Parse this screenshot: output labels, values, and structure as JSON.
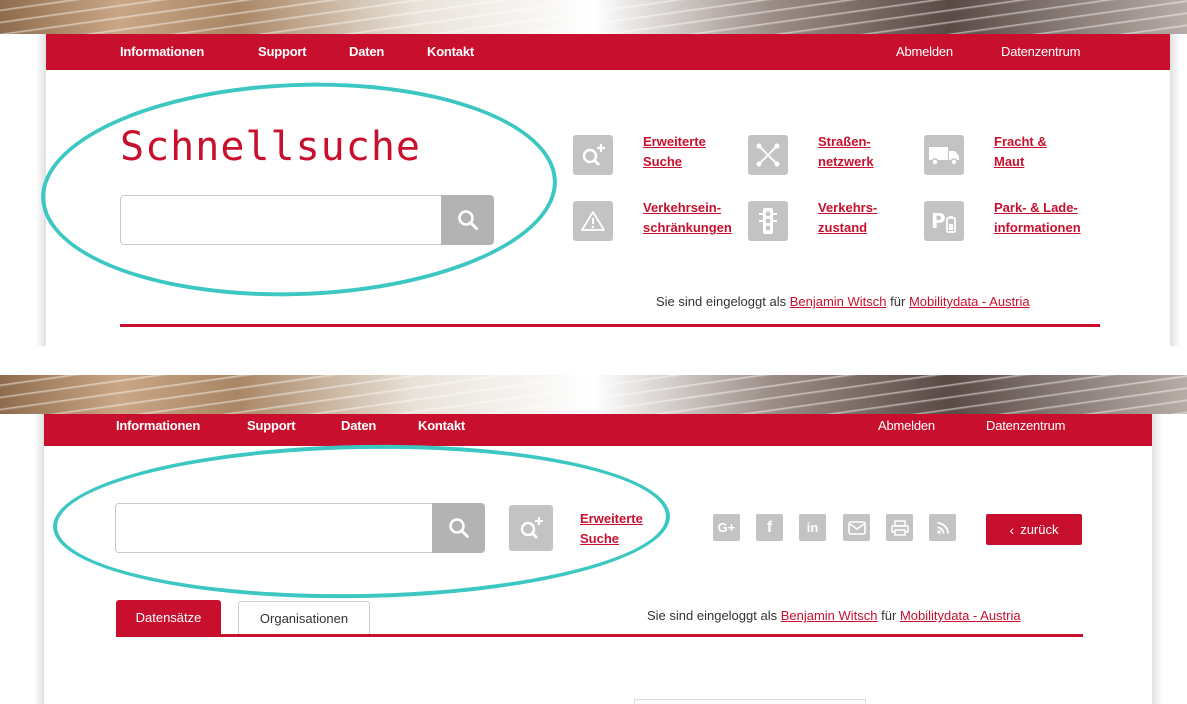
{
  "nav": {
    "left": [
      "Informationen",
      "Support",
      "Daten",
      "Kontakt"
    ],
    "right": [
      "Abmelden",
      "Datenzentrum"
    ]
  },
  "quick_search": {
    "title": "Schnellsuche",
    "search_value": ""
  },
  "quick_links": [
    {
      "icon": "search-plus-icon",
      "line1": "Erweiterte",
      "line2": "Suche"
    },
    {
      "icon": "road-network-icon",
      "line1": "Straßen-",
      "line2": "netzwerk"
    },
    {
      "icon": "truck-icon",
      "line1": "Fracht &",
      "line2": "Maut"
    },
    {
      "icon": "warning-icon",
      "line1": "Verkehrsein-",
      "line2": "schränkungen"
    },
    {
      "icon": "traffic-light-icon",
      "line1": "Verkehrs-",
      "line2": "zustand"
    },
    {
      "icon": "parking-charging-icon",
      "line1": "Park- & Lade-",
      "line2": "informationen"
    }
  ],
  "login": {
    "prefix": "Sie sind eingeloggt als",
    "user": "Benjamin Witsch",
    "middle": "für",
    "org": "Mobilitydata - Austria"
  },
  "results_page": {
    "advanced_search_line1": "Erweiterte",
    "advanced_search_line2": "Suche",
    "social_icons": [
      "G+",
      "f",
      "in",
      "mail",
      "print",
      "rss"
    ],
    "back_label": "zurück",
    "tabs": [
      "Datensätze",
      "Organisationen"
    ]
  },
  "colors": {
    "brand_red": "#c8102e",
    "highlight_teal": "#3cc7c3",
    "icon_grey": "#c3c3c3"
  }
}
